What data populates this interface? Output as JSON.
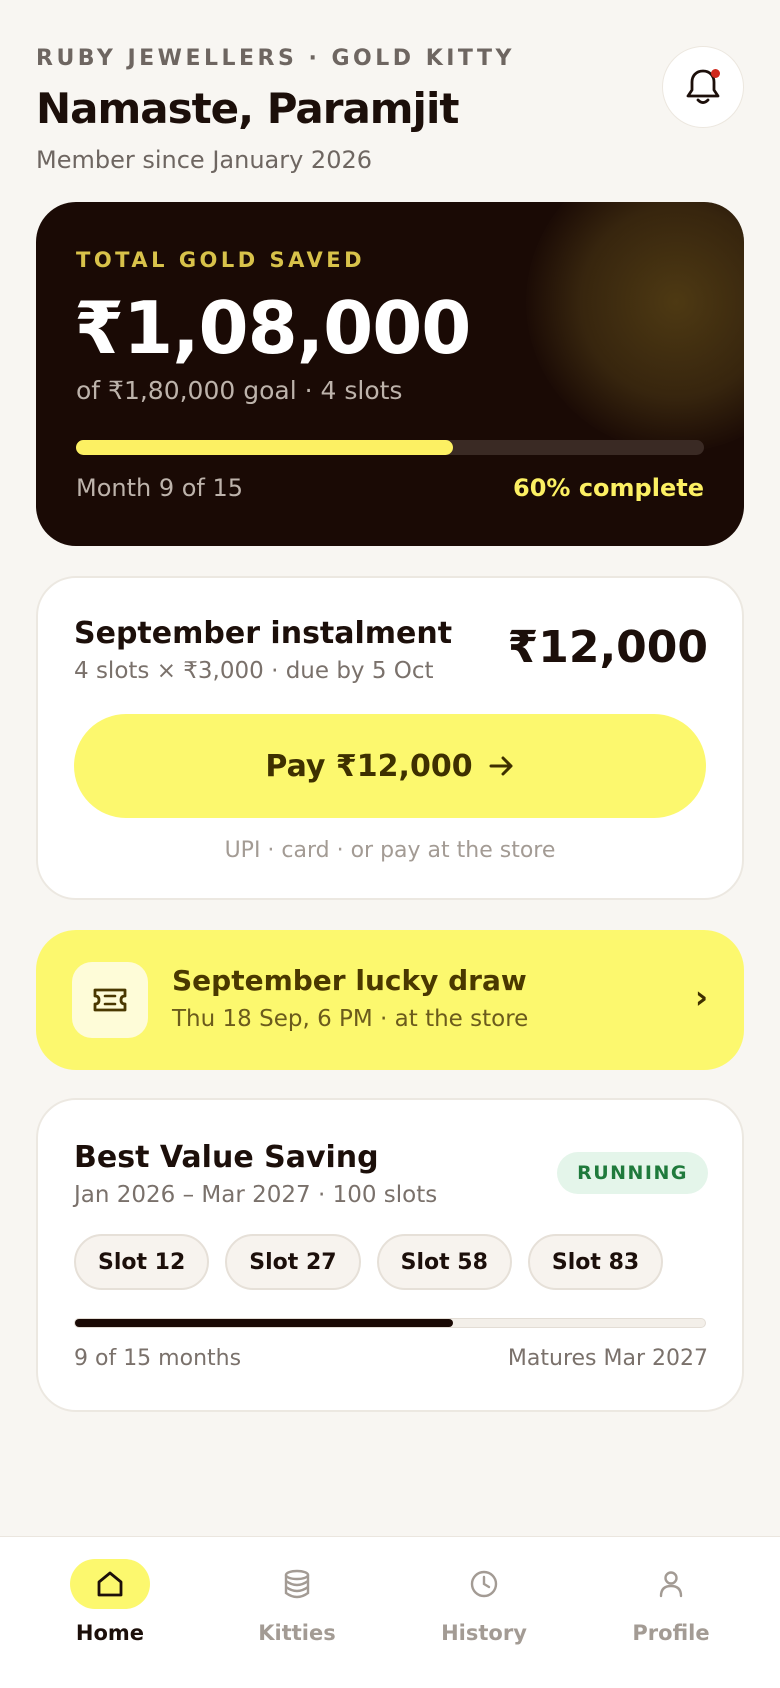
{
  "header": {
    "eyebrow": "RUBY JEWELLERS · GOLD KITTY",
    "greeting": "Namaste, Paramjit",
    "member_since": "Member since January 2026",
    "notification_icon": "bell-icon",
    "has_unread": true
  },
  "hero": {
    "label": "TOTAL GOLD SAVED",
    "amount": "₹1,08,000",
    "goal_text": "of ₹1,80,000 goal · 4 slots",
    "progress_percent": 60,
    "month_text": "Month 9 of 15",
    "percent_text": "60% complete"
  },
  "instalment": {
    "title": "September instalment",
    "details": "4 slots × ₹3,000 · due by 5 Oct",
    "amount": "₹12,000",
    "pay_label": "Pay ₹12,000",
    "pay_icon": "arrow-right-icon",
    "note": "UPI · card · or pay at the store"
  },
  "lucky_draw": {
    "icon": "ticket-icon",
    "title": "September lucky draw",
    "details": "Thu 18 Sep, 6 PM · at the store",
    "chevron": "›"
  },
  "kitty": {
    "name": "Best Value Saving",
    "details": "Jan 2026 – Mar 2027 · 100 slots",
    "status": "RUNNING",
    "slots": [
      "Slot 12",
      "Slot 27",
      "Slot 58",
      "Slot 83"
    ],
    "progress_fraction": 0.6,
    "months_text": "9 of 15 months",
    "matures_text": "Matures Mar 2027"
  },
  "nav": {
    "items": [
      {
        "label": "Home",
        "icon": "home-icon",
        "active": true
      },
      {
        "label": "Kitties",
        "icon": "database-icon",
        "active": false
      },
      {
        "label": "History",
        "icon": "clock-icon",
        "active": false
      },
      {
        "label": "Profile",
        "icon": "user-icon",
        "active": false
      }
    ]
  },
  "colors": {
    "accent_yellow": "#fcf86e",
    "dark_card": "#1a0a05",
    "gold_label": "#d8c24a",
    "running_badge": "#1f7a3c",
    "background": "#f8f6f2"
  }
}
